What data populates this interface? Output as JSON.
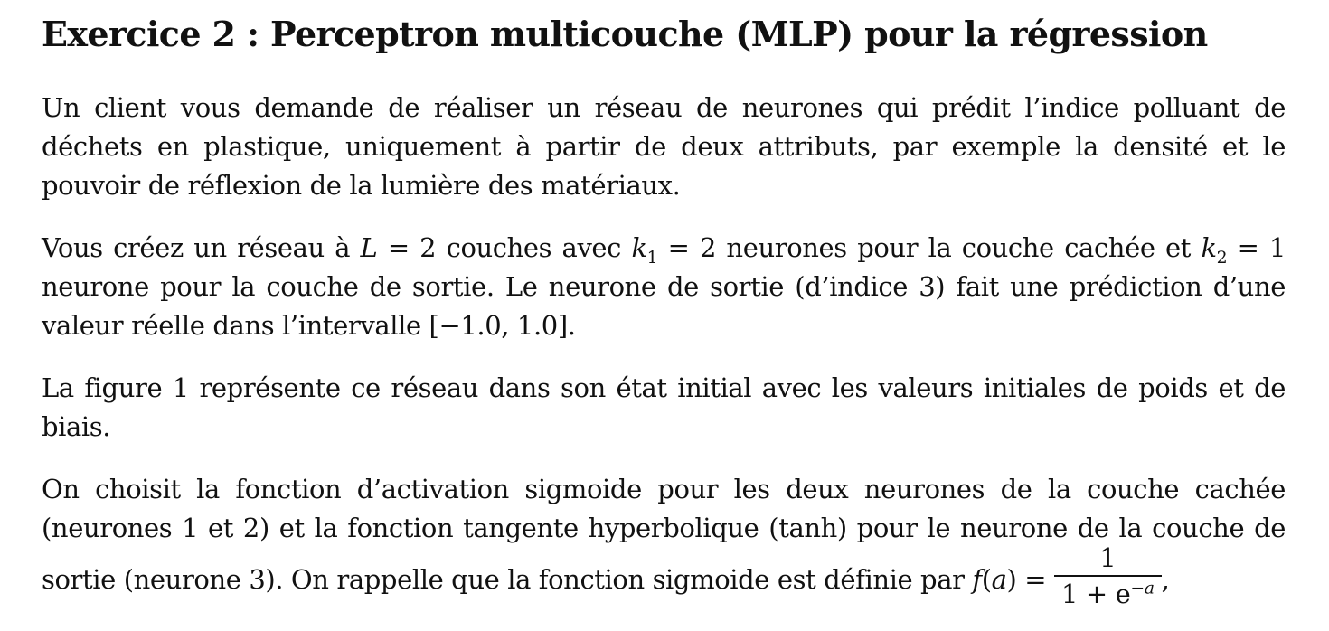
{
  "title": "Exercice 2 : Perceptron multicouche (MLP) pour la régression",
  "para1": "Un client vous demande de réaliser un réseau de neurones qui prédit l’indice polluant de déchets en plastique, uniquement à partir de deux attributs, par exemple la densité et le pouvoir de réflexion de la lumière des matériaux.",
  "para2": {
    "t1": "Vous créez un réseau à ",
    "m1": "L",
    "m1b": " = 2",
    "t2": " couches avec ",
    "m2": "k",
    "m2sub": "1",
    "m2b": " = 2",
    "t3": " neurones pour la couche cachée et ",
    "m3": "k",
    "m3sub": "2",
    "m3b": " = 1",
    "t4": " neurone pour la couche de sortie. Le neurone de sortie (d’indice 3) fait une prédiction d’une valeur réelle dans l’intervalle ",
    "m4": "[−1.0, 1.0]",
    "t5": "."
  },
  "para3": "La figure 1 représente ce réseau dans son état initial avec les valeurs initiales de poids et de biais.",
  "para4": {
    "t1": "On choisit la fonction d’activation sigmoide pour les deux neurones de la couche cachée (neurones 1 et 2) et la fonction tangente hyperbolique (tanh) pour le neurone de la couche de sortie (neurone 3). On rappelle que la fonction sigmoide est définie par ",
    "m1": "f",
    "m1b": "(",
    "m1c": "a",
    "m1d": ") =",
    "frac_num": "1",
    "frac_den": "1 + e",
    "frac_exp": "−a",
    "t2": ","
  }
}
